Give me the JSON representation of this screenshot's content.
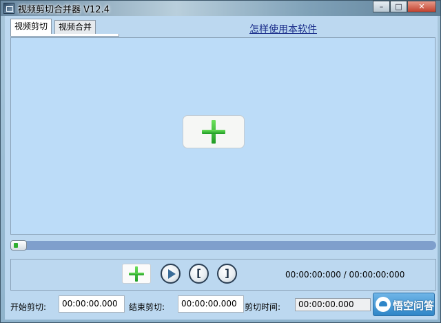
{
  "window": {
    "title": "视频剪切合并器 V12.4",
    "minimize_label": "–",
    "maximize_label": "□",
    "close_label": "✕"
  },
  "tabs": [
    {
      "label": "视频剪切",
      "active": true
    },
    {
      "label": "视频合并",
      "active": false
    }
  ],
  "help_link": "怎样使用本软件",
  "preview": {
    "add_icon": "plus-icon"
  },
  "timeline": {
    "position": 0
  },
  "controls": {
    "add_icon": "plus-icon",
    "play_icon": "play-icon",
    "mark_in_label": "[",
    "mark_out_label": "]",
    "time_readout": "00:00:00:000 / 00:00:00:000"
  },
  "cut": {
    "start_label": "开始剪切:",
    "start_value": "00:00:00.000",
    "end_label": "结束剪切:",
    "end_value": "00:00:00.000",
    "duration_label": "剪切时间:",
    "duration_value": "00:00:00.000"
  },
  "watermark": {
    "text": "悟空问答"
  },
  "colors": {
    "panel_bg": "#bcd8f0",
    "preview_bg": "#bcdcf8",
    "accent_green": "#1f9b25",
    "timeline": "#7f9fcc"
  }
}
